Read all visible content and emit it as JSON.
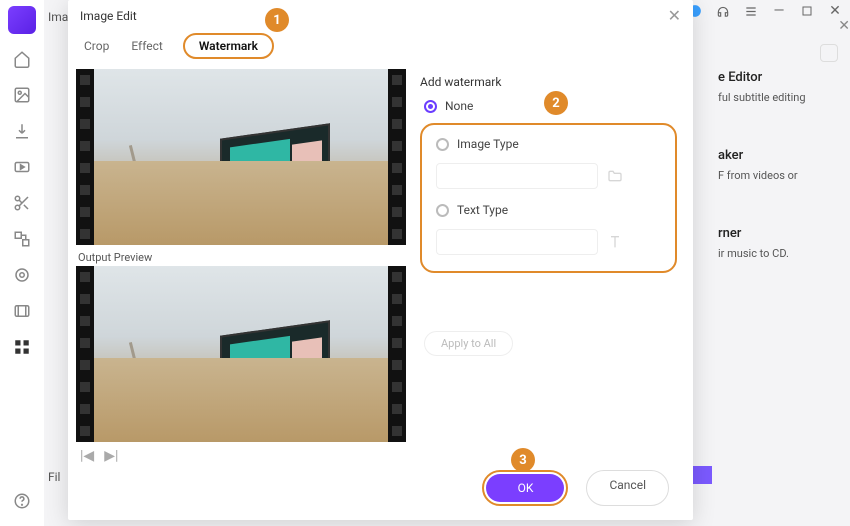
{
  "sidebar": {
    "icons": [
      "home",
      "image",
      "download",
      "video",
      "scissors",
      "grid",
      "target",
      "film",
      "apps"
    ]
  },
  "bg": {
    "header_label": "Imag",
    "file_label": "Fil",
    "cards": [
      {
        "title": "e Editor",
        "desc": "ful subtitle editing"
      },
      {
        "title": "aker",
        "desc": "F from videos or"
      },
      {
        "title": "rner",
        "desc": "ir music to CD."
      }
    ]
  },
  "dialog": {
    "title": "Image Edit",
    "tabs": {
      "crop": "Crop",
      "effect": "Effect",
      "watermark": "Watermark"
    },
    "output_label": "Output Preview",
    "section_title": "Add watermark",
    "options": {
      "none": "None",
      "image_type": "Image Type",
      "text_type": "Text Type"
    },
    "apply_all": "Apply to All",
    "ok": "OK",
    "cancel": "Cancel"
  },
  "callouts": {
    "c1": "1",
    "c2": "2",
    "c3": "3"
  }
}
